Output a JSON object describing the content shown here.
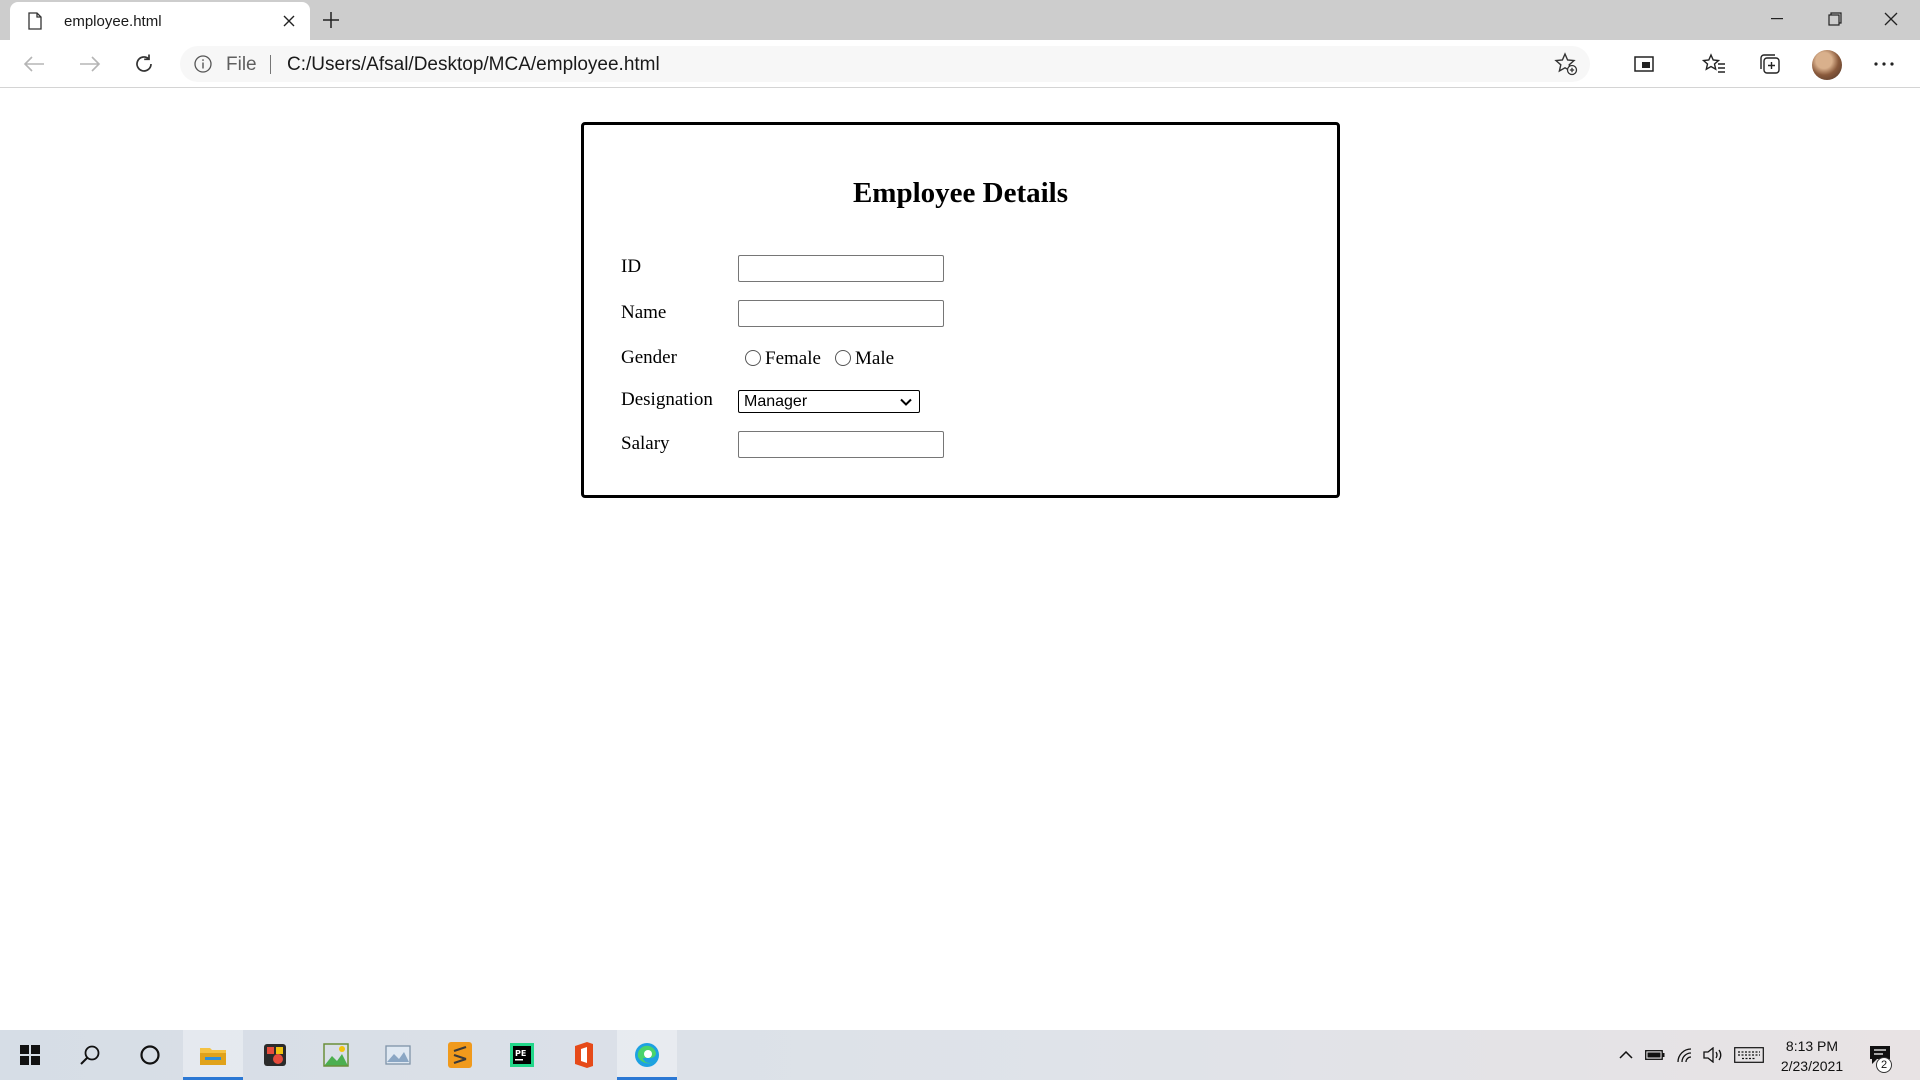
{
  "browser": {
    "tab": {
      "title": "employee.html"
    },
    "address_bar": {
      "scheme_label": "File",
      "url": "C:/Users/Afsal/Desktop/MCA/employee.html"
    }
  },
  "form": {
    "title": "Employee Details",
    "fields": {
      "id": {
        "label": "ID",
        "value": ""
      },
      "name": {
        "label": "Name",
        "value": ""
      },
      "gender": {
        "label": "Gender",
        "options": [
          "Female",
          "Male"
        ],
        "selected": null
      },
      "designation": {
        "label": "Designation",
        "selected": "Manager"
      },
      "salary": {
        "label": "Salary",
        "value": ""
      }
    }
  },
  "taskbar": {
    "apps": [
      "start-icon",
      "search-icon",
      "cortana-icon",
      "file-explorer-icon",
      "media-app-icon",
      "photo-app-icon",
      "image-viewer-icon",
      "sublime-text-icon",
      "pycharm-icon",
      "office-icon",
      "edge-icon"
    ],
    "clock": {
      "time": "8:13 PM",
      "date": "2/23/2021"
    },
    "notification_count": "2"
  },
  "colors": {
    "accent": "#2b78d4",
    "tabstrip": "#cdcdcd"
  }
}
